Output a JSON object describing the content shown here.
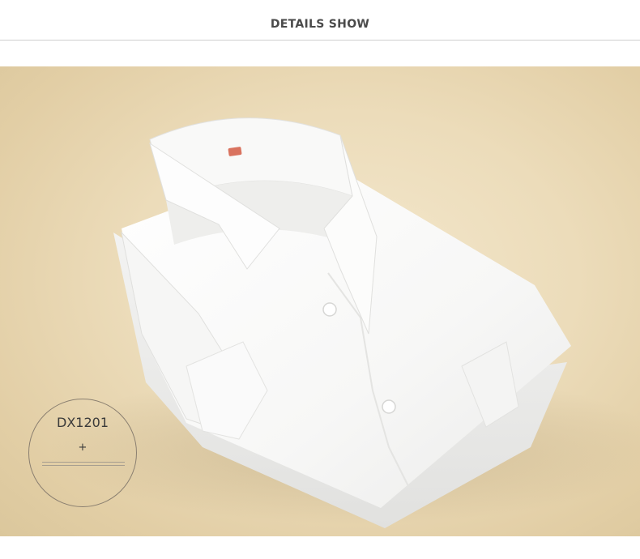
{
  "header": {
    "title": "DETAILS SHOW"
  },
  "badge": {
    "code": "DX1201",
    "plus": "+"
  },
  "photo": {
    "subject": "shirt-photo",
    "background_color": "#e8d7b2",
    "shirt_color": "#fbfbfa",
    "label_color": "#d9735f"
  }
}
